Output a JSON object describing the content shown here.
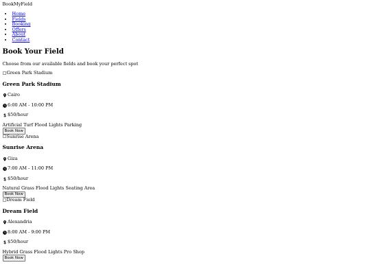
{
  "brand": "BookMyField",
  "nav": [
    "Home",
    "Fields",
    "Booking",
    "Offers",
    "About",
    "Contact"
  ],
  "hero": {
    "title": "Book Your Field",
    "subtitle": "Choose from our available fields and book your perfect spot"
  },
  "fields": [
    {
      "image_alt": "Green Park Stadium",
      "name": "Green Park Stadium",
      "location": "Cairo",
      "hours": "6:00 AM - 10:00 PM",
      "price": "$50/hour",
      "features": [
        "Artificial Turf",
        "Flood Lights",
        "Parking"
      ],
      "book_label": "Book Now"
    },
    {
      "image_alt": "Sunrise Arena",
      "name": "Sunrise Arena",
      "location": "Giza",
      "hours": "7:00 AM - 11:00 PM",
      "price": "$50/hour",
      "features": [
        "Natural Grass",
        "Flood Lights",
        "Seating Area"
      ],
      "book_label": "Book Now"
    },
    {
      "image_alt": "Dream Field",
      "name": "Dream Field",
      "location": "Alexandria",
      "hours": "8:00 AM - 9:00 PM",
      "price": "$50/hour",
      "features": [
        "Hybrid Grass",
        "Flood Lights",
        "Pro Shop"
      ],
      "book_label": "Book Now"
    }
  ],
  "icons": {
    "location": "map-marker-icon",
    "hours": "clock-icon",
    "price": "dollar-icon"
  }
}
